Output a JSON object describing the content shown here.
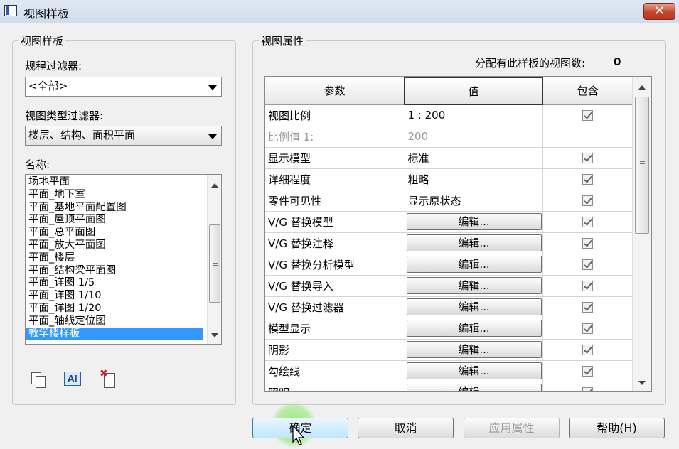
{
  "window": {
    "title": "视图样板",
    "close_glyph": "✕"
  },
  "left_panel": {
    "group_title": "视图样板",
    "discipline_filter": {
      "label": "规程过滤器:",
      "value": "<全部>"
    },
    "view_type_filter": {
      "label": "视图类型过滤器:",
      "value": "楼层、结构、面积平面"
    },
    "names": {
      "label": "名称:",
      "items": [
        "场地平面",
        "平面_地下室",
        "平面_基地平面配置图",
        "平面_屋顶平面图",
        "平面_总平面图",
        "平面_放大平面图",
        "平面_楼层",
        "平面_结构梁平面图",
        "平面_详图 1/5",
        "平面_详图 1/10",
        "平面_详图 1/20",
        "平面_轴线定位图",
        "教学楼样板"
      ],
      "selected_index": 12
    },
    "tools": {
      "duplicate": "duplicate-icon",
      "rename": "rename-icon",
      "rename_glyph": "AI",
      "delete": "delete-icon",
      "delete_glyph": "✖"
    }
  },
  "right_panel": {
    "group_title": "视图属性",
    "assigned_count_label": "分配有此样板的视图数:",
    "assigned_count_value": "0",
    "columns": [
      "参数",
      "值",
      "包含"
    ],
    "rows": [
      {
        "param": "视图比例",
        "value": "1 : 200",
        "type": "text",
        "include": true,
        "enabled": true
      },
      {
        "param": "比例值 1:",
        "value": "200",
        "type": "text",
        "include": null,
        "enabled": false
      },
      {
        "param": "显示模型",
        "value": "标准",
        "type": "text",
        "include": true,
        "enabled": true
      },
      {
        "param": "详细程度",
        "value": "粗略",
        "type": "text",
        "include": true,
        "enabled": true
      },
      {
        "param": "零件可见性",
        "value": "显示原状态",
        "type": "text",
        "include": true,
        "enabled": true
      },
      {
        "param": "V/G 替换模型",
        "value": "编辑...",
        "type": "button",
        "include": true,
        "enabled": true
      },
      {
        "param": "V/G 替换注释",
        "value": "编辑...",
        "type": "button",
        "include": true,
        "enabled": true
      },
      {
        "param": "V/G 替换分析模型",
        "value": "编辑...",
        "type": "button",
        "include": true,
        "enabled": true
      },
      {
        "param": "V/G 替换导入",
        "value": "编辑...",
        "type": "button",
        "include": true,
        "enabled": true
      },
      {
        "param": "V/G 替换过滤器",
        "value": "编辑...",
        "type": "button",
        "include": true,
        "enabled": true
      },
      {
        "param": "模型显示",
        "value": "编辑...",
        "type": "button",
        "include": true,
        "enabled": true
      },
      {
        "param": "阴影",
        "value": "编辑...",
        "type": "button",
        "include": true,
        "enabled": true
      },
      {
        "param": "勾绘线",
        "value": "编辑...",
        "type": "button",
        "include": true,
        "enabled": true
      },
      {
        "param": "照明",
        "value": "编辑...",
        "type": "button",
        "include": true,
        "enabled": true
      }
    ]
  },
  "buttons": {
    "ok": "确定",
    "cancel": "取消",
    "apply": "应用属性",
    "help": "帮助(H)"
  },
  "colors": {
    "selection": "#3399ff",
    "close_button": "#c5452b",
    "click_highlight": "#78e650"
  }
}
